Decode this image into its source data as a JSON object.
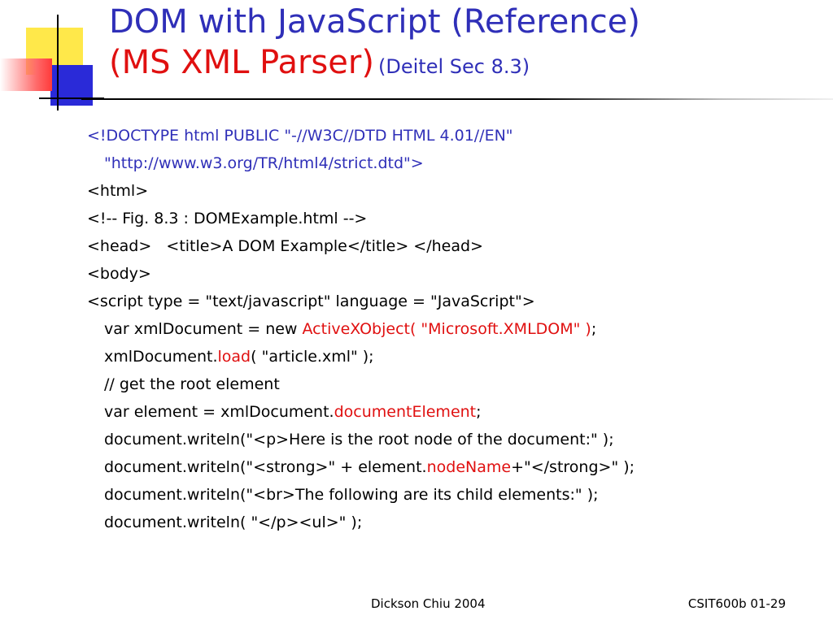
{
  "title": {
    "line1": "DOM with JavaScript (Reference)",
    "line2_main": "(MS XML Parser)",
    "line2_ref": "(Deitel Sec 8.3)"
  },
  "code": {
    "doctype1": "<!DOCTYPE html PUBLIC \"-//W3C//DTD HTML 4.01//EN\"",
    "doctype2": "\"http://www.w3.org/TR/html4/strict.dtd\">",
    "html_open": "<html>",
    "comment": "<!-- Fig. 8.3 : DOMExample.html -->",
    "head": "<head>   <title>A DOM Example</title> </head>",
    "body_open": "<body>",
    "script_open": "<script type = \"text/javascript\" language = \"JavaScript\">",
    "var_doc_pre": "var xmlDocument = new ",
    "var_doc_red": "ActiveXObject( \"Microsoft.XMLDOM\" )",
    "var_doc_post": ";",
    "load_pre": "xmlDocument.",
    "load_red": "load",
    "load_post": "( \"article.xml\" );",
    "comment_root": "// get the root element",
    "element_pre": "var element = xmlDocument.",
    "element_red": "documentElement",
    "element_post": ";",
    "write1": "document.writeln(\"<p>Here is the root node of the document:\" );",
    "write2_pre": "document.writeln(\"<strong>\" + element.",
    "write2_red": "nodeName",
    "write2_post": "+\"</strong>\" );",
    "write3": "document.writeln(\"<br>The following are its child elements:\" );",
    "write4": "document.writeln( \"</p><ul>\" );"
  },
  "footer": {
    "author": "Dickson Chiu 2004",
    "slide_ref": "CSIT600b 01-29"
  },
  "colors": {
    "title_blue": "#2f2fb8",
    "highlight_red": "#e01010",
    "deco_yellow": "#ffe84a",
    "deco_blue": "#2a2ad8",
    "deco_red": "#ff3a3a"
  }
}
